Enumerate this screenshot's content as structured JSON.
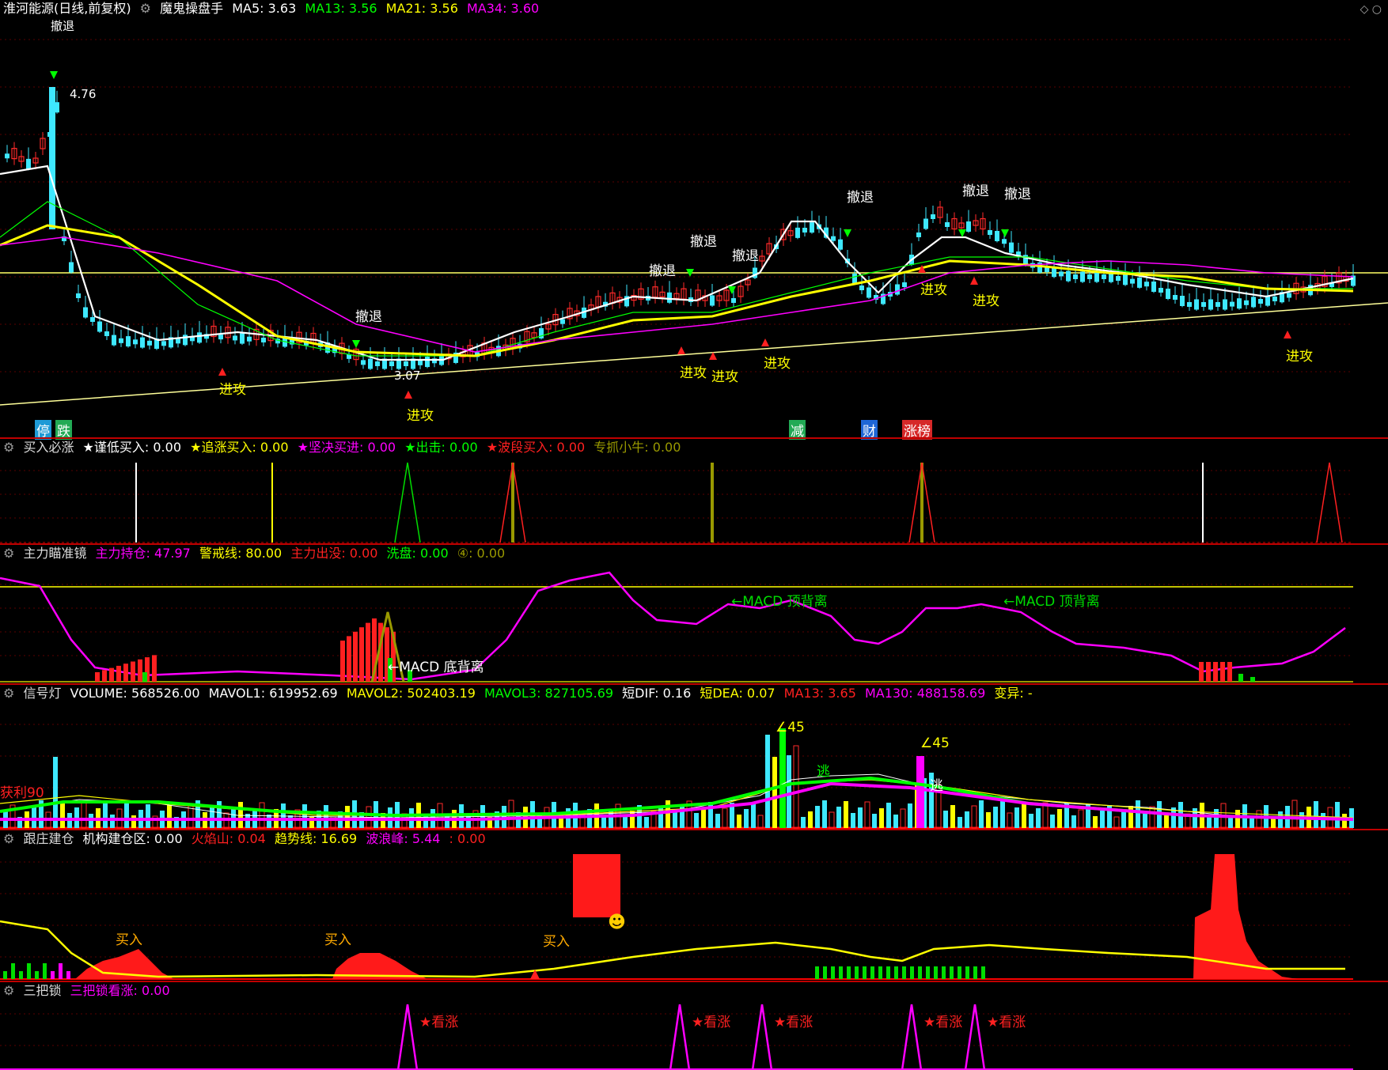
{
  "main": {
    "stock_name": "淮河能源(日线,前复权)",
    "indicator_name": "魔鬼操盘手",
    "ma": [
      {
        "label": "MA5: 3.63",
        "color": "#ffffff"
      },
      {
        "label": "MA13: 3.56",
        "color": "#00ff00"
      },
      {
        "label": "MA21: 3.56",
        "color": "#ffff00"
      },
      {
        "label": "MA34: 3.60",
        "color": "#ff00ff"
      }
    ],
    "high_label": "4.76",
    "low_label": "3.07",
    "top_cut_label": "撤退",
    "annotations": {
      "retreat": "撤退",
      "attack": "进攻"
    },
    "bottom_badges": [
      {
        "label": "停",
        "color": "#1e9ad6"
      },
      {
        "label": "跌",
        "color": "#22aa55"
      },
      {
        "label": "减",
        "color": "#22aa55"
      },
      {
        "label": "财",
        "color": "#1e66d6"
      },
      {
        "label": "涨榜",
        "color": "#d62828"
      }
    ]
  },
  "panel1": {
    "title": "买入必涨",
    "items": [
      {
        "label": "★谨低买入: 0.00",
        "color": "#ffffff"
      },
      {
        "label": "★追涨买入: 0.00",
        "color": "#ffff00"
      },
      {
        "label": "★坚决买进: 0.00",
        "color": "#ff00ff"
      },
      {
        "label": "★出击: 0.00",
        "color": "#00ff00"
      },
      {
        "label": "★波段买入: 0.00",
        "color": "#ff2020"
      },
      {
        "label": "专抓小牛: 0.00",
        "color": "#999900"
      }
    ]
  },
  "panel2": {
    "title": "主力瞄准镜",
    "items": [
      {
        "label": "主力持仓: 47.97",
        "color": "#ff00ff"
      },
      {
        "label": "警戒线: 80.00",
        "color": "#ffff00"
      },
      {
        "label": "主力出没: 0.00",
        "color": "#ff2020"
      },
      {
        "label": "洗盘: 0.00",
        "color": "#00ff00"
      },
      {
        "label": "④: 0.00",
        "color": "#999900"
      }
    ],
    "macd_top": "←MACD 顶背离",
    "macd_bottom": "←MACD 底背离"
  },
  "panel3": {
    "title": "信号灯",
    "items": [
      {
        "label": "VOLUME: 568526.00",
        "color": "#ffffff"
      },
      {
        "label": "MAVOL1: 619952.69",
        "color": "#ffffff"
      },
      {
        "label": "MAVOL2: 502403.19",
        "color": "#ffff00"
      },
      {
        "label": "MAVOL3: 827105.69",
        "color": "#00ff00"
      },
      {
        "label": "短DIF: 0.16",
        "color": "#ffffff"
      },
      {
        "label": "短DEA: 0.07",
        "color": "#ffff00"
      },
      {
        "label": "MA13: 3.65",
        "color": "#ff2020"
      },
      {
        "label": "MA130: 488158.69",
        "color": "#ff00ff"
      },
      {
        "label": "变异: -",
        "color": "#ffff00"
      }
    ],
    "angle_label": "∠45",
    "profit_label": "获利90",
    "escape_label": "逃"
  },
  "panel4": {
    "title": "跟庄建仓",
    "items": [
      {
        "label": "机构建仓区: 0.00",
        "color": "#ffffff"
      },
      {
        "label": "火焰山: 0.04",
        "color": "#ff2020"
      },
      {
        "label": "趋势线: 16.69",
        "color": "#ffff00"
      },
      {
        "label": "波浪峰: 5.44",
        "color": "#ff00ff"
      },
      {
        "label": ": 0.00",
        "color": "#ff2020"
      }
    ],
    "buy_label": "买入"
  },
  "panel5": {
    "title": "三把锁",
    "items": [
      {
        "label": "三把锁看涨: 0.00",
        "color": "#ff00ff"
      }
    ],
    "bull_label": "★看涨"
  }
}
